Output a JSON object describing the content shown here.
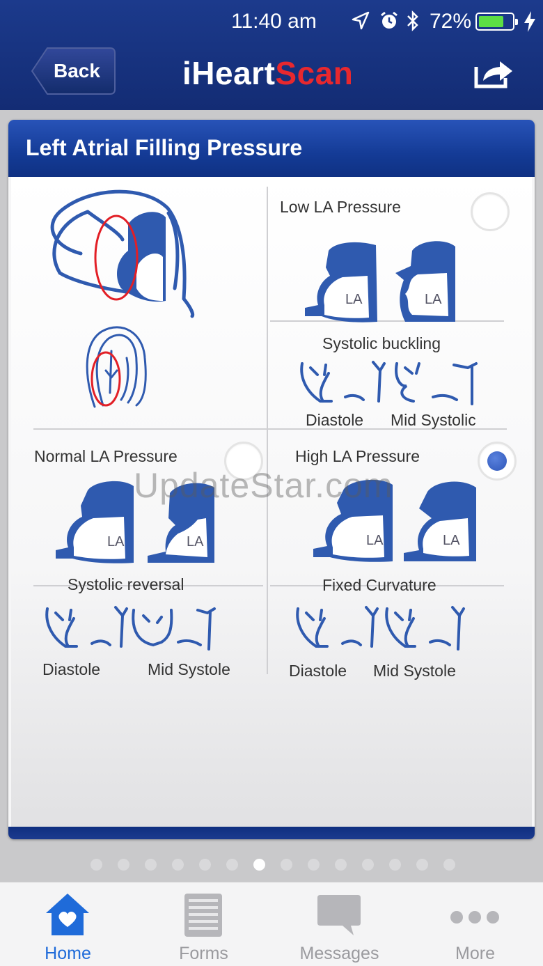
{
  "status": {
    "time": "11:40 am",
    "battery_pct": "72%",
    "battery_level": 0.72
  },
  "header": {
    "back_label": "Back",
    "title_part1": "iHeart",
    "title_part2": "Scan",
    "share_icon": "share-icon",
    "brand_color": "#15307a",
    "accent_color": "#e8282e"
  },
  "card": {
    "title": "Left Atrial Filling Pressure",
    "options": [
      {
        "label": "Low LA Pressure",
        "selected": false,
        "caption": "Systolic buckling",
        "phase_labels": [
          "Diastole",
          "Mid Systolic"
        ],
        "la_labels": [
          "LA",
          "LA"
        ]
      },
      {
        "label": "Normal LA Pressure",
        "selected": false,
        "caption": "Systolic reversal",
        "phase_labels": [
          "Diastole",
          "Mid Systole"
        ],
        "la_labels": [
          "LA",
          "LA"
        ]
      },
      {
        "label": "High LA Pressure",
        "selected": true,
        "caption": "Fixed Curvature",
        "phase_labels": [
          "Diastole",
          "Mid Systole"
        ],
        "la_labels": [
          "LA",
          "LA"
        ]
      }
    ]
  },
  "watermark": "UpdateStar.com",
  "pager": {
    "count": 14,
    "active_index": 6
  },
  "tabbar": {
    "tabs": [
      {
        "label": "Home",
        "icon": "home-icon",
        "active": true
      },
      {
        "label": "Forms",
        "icon": "forms-icon",
        "active": false
      },
      {
        "label": "Messages",
        "icon": "messages-icon",
        "active": false
      },
      {
        "label": "More",
        "icon": "more-icon",
        "active": false
      }
    ]
  }
}
